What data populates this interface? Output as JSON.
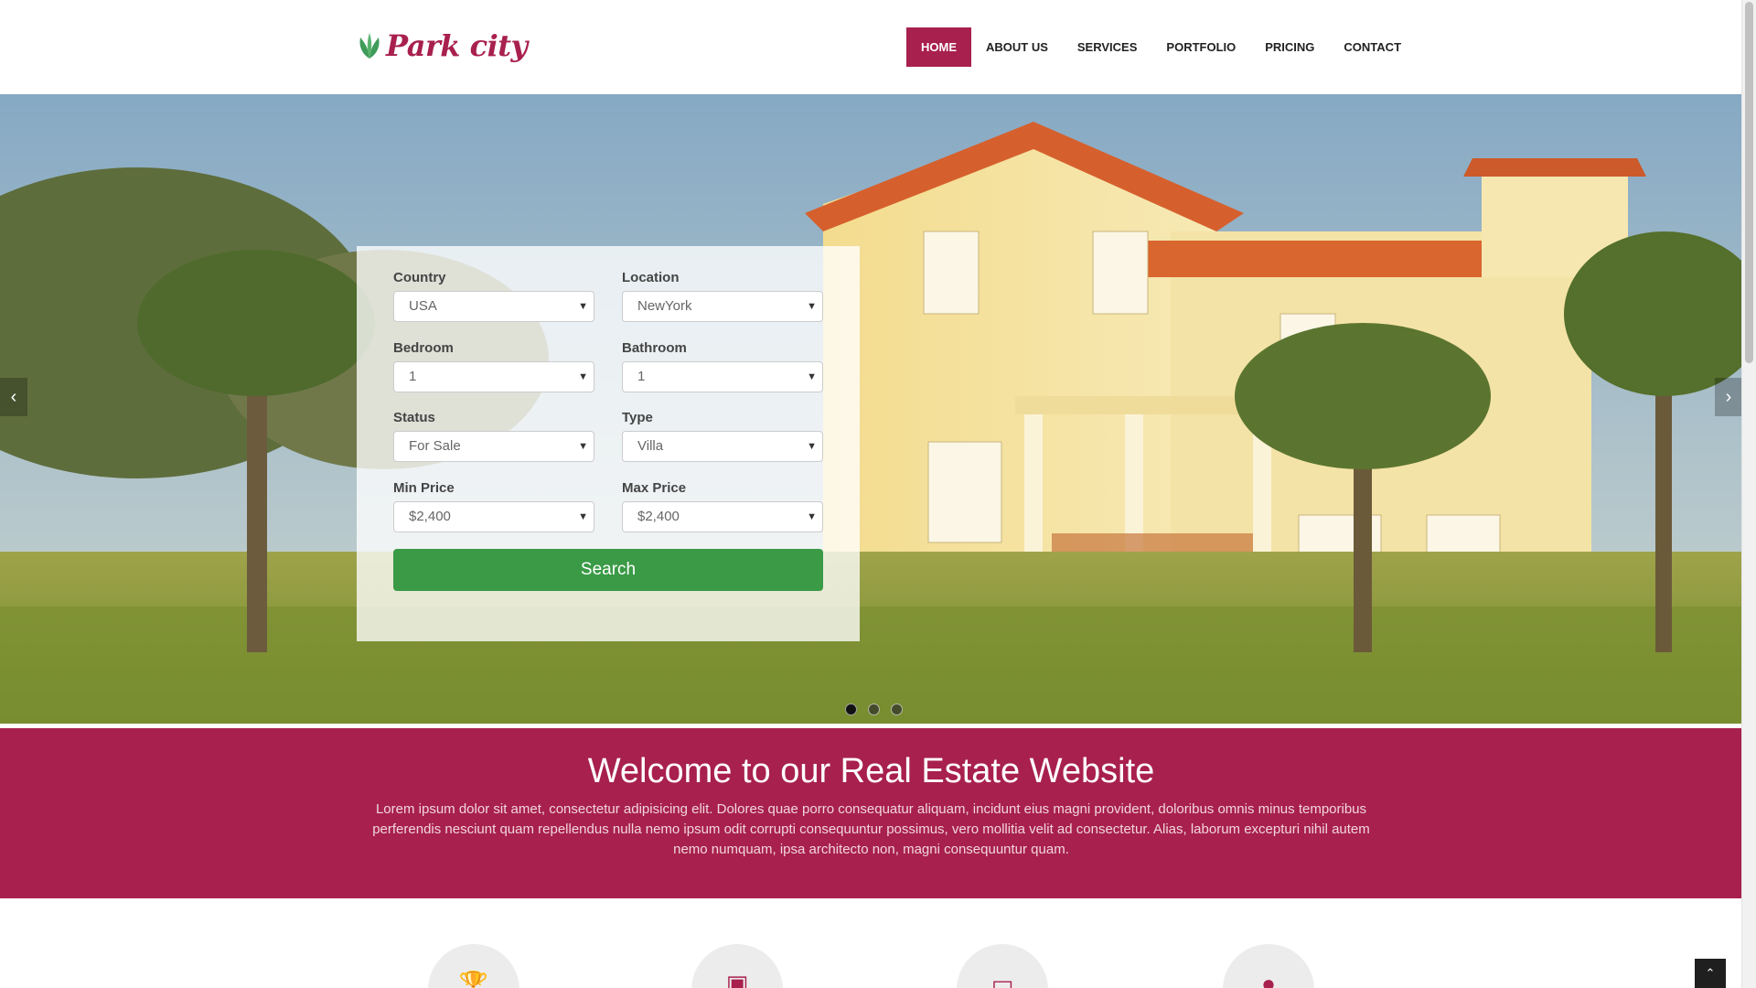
{
  "brand": {
    "name": "Park city",
    "color": "#a8204d"
  },
  "nav": {
    "items": [
      {
        "label": "HOME",
        "active": true
      },
      {
        "label": "ABOUT US"
      },
      {
        "label": "SERVICES"
      },
      {
        "label": "PORTFOLIO"
      },
      {
        "label": "PRICING"
      },
      {
        "label": "CONTACT"
      }
    ]
  },
  "search": {
    "fields": {
      "country": {
        "label": "Country",
        "value": "USA"
      },
      "location": {
        "label": "Location",
        "value": "NewYork"
      },
      "bedroom": {
        "label": "Bedroom",
        "value": "1"
      },
      "bathroom": {
        "label": "Bathroom",
        "value": "1"
      },
      "status": {
        "label": "Status",
        "value": "For Sale"
      },
      "type": {
        "label": "Type",
        "value": "Villa"
      },
      "min_price": {
        "label": "Min Price",
        "value": "$2,400"
      },
      "max_price": {
        "label": "Max Price",
        "value": "$2,400"
      }
    },
    "button_label": "Search",
    "button_color": "#3a9a46"
  },
  "slider": {
    "slide_count": 3,
    "active_slide": 1
  },
  "welcome": {
    "title": "Welcome to our Real Estate Website",
    "body": "Lorem ipsum dolor sit amet, consectetur adipisicing elit. Dolores quae porro consequatur aliquam, incidunt eius magni provident, doloribus omnis minus temporibus perferendis nesciunt quam repellendus nulla nemo ipsum odit corrupti consequuntur possimus, vero mollitia velit ad consectetur. Alias, laborum excepturi nihil autem nemo numquam, ipsa architecto non, magni consequuntur quam."
  },
  "features": {
    "icons": [
      "trophy-icon",
      "picture-icon",
      "monitor-icon",
      "globe-icon"
    ]
  }
}
